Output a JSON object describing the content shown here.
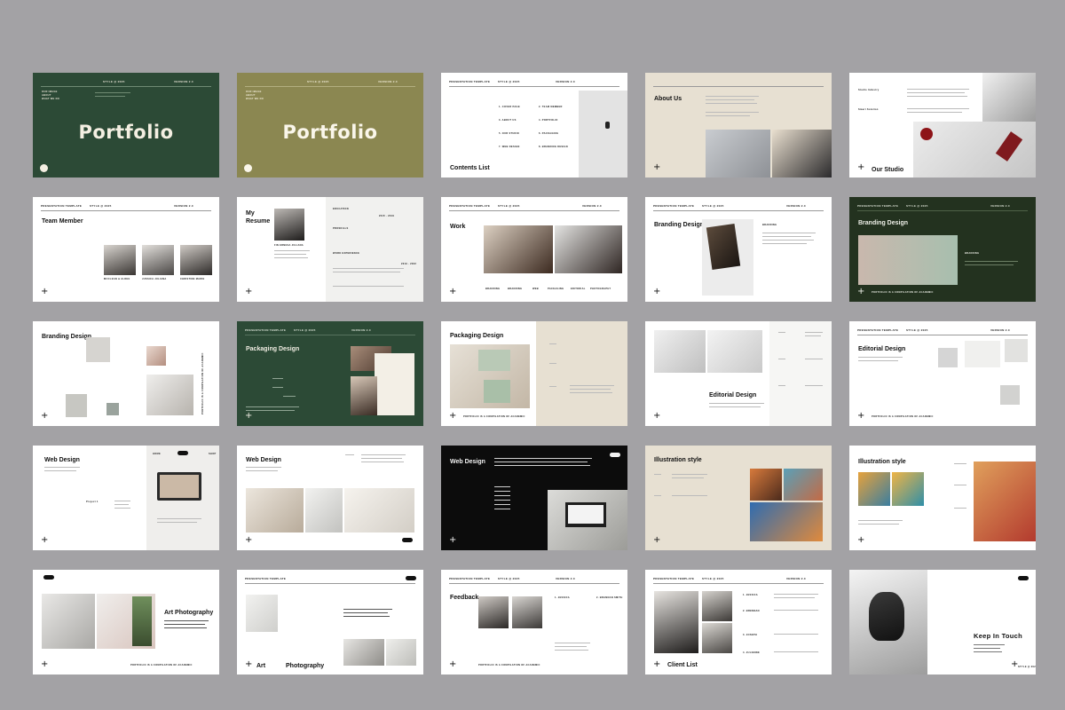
{
  "colors": {
    "background": "#a3a2a5",
    "forest": "#2c4a36",
    "olive": "#8b8751",
    "beige": "#e7e0d2",
    "darkgreen": "#23321f"
  },
  "header": {
    "template": "PRESENTATION TEMPLATE",
    "style": "STYLE @ 2025",
    "version": "VERSION 2.0"
  },
  "slides": {
    "portfolio_title": "Portfolio",
    "portfolio_menu": [
      "OUR IMAGE",
      "ABOUT",
      "WHAT WE DO"
    ],
    "contents_title": "Contents List",
    "contents_items": [
      "1. COVER PAGE",
      "2. TEAM MEMBER",
      "3. ABOUT US",
      "4. PORTFOLIO",
      "5. OUR STUDIO",
      "6. PACKAGING",
      "7. WEB DESIGN",
      "8. BRANDING DESIGN"
    ],
    "about_title": "About Us",
    "studio_title": "Our Studio",
    "studio_labels": [
      "Studio Industry",
      "Smart Solution"
    ],
    "team_title": "Team Member",
    "team_names": [
      "MCCLEAN & ALDEE",
      "JUSSICA JULIANA",
      "CHRISTINE MARIE"
    ],
    "resume_title": "My Resume",
    "resume_name": "FIN ERNESA JULIANA",
    "resume_sections": [
      "EDUCATION",
      "PROSKILLS",
      "WORK EXPERIENCE"
    ],
    "resume_years": [
      "2015 - 2019",
      "2019 - 2022"
    ],
    "work_title": "Work",
    "work_tags": [
      "BRANDING",
      "BRANDING",
      "WEB",
      "PACKAGING",
      "EDITORIAL",
      "PHOTOGRAPHY"
    ],
    "branding_title": "Branding Design",
    "branding_tag": "BRANDING",
    "tagline": "PORTFOLIO IS A COMPILATION OF ACADEMIC",
    "packaging_title": "Packaging Design",
    "editorial_title": "Editorial Design",
    "web_title": "Web Design",
    "web_tabs": [
      "HOME",
      "WEB",
      "SHOP"
    ],
    "web_project": "Project 1",
    "illustration_title": "Illustration style",
    "art_title": "Art Photography",
    "art_word": "Art",
    "photo_word": "Photography",
    "feedback_title": "Feedback",
    "feedback_names": [
      "1. JESSICA",
      "2. BRANNAN SMITH"
    ],
    "client_title": "Client List",
    "client_items": [
      "1. JESSICA",
      "2. BRENNAN",
      "3. JOSEPH",
      "4. JULIENNE"
    ],
    "touch_title": "Keep In Touch"
  }
}
